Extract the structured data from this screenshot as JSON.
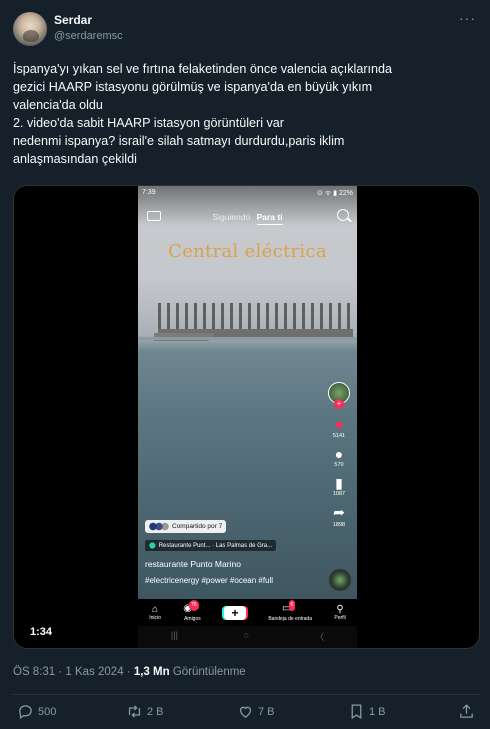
{
  "tweet": {
    "author_name": "Serdar",
    "author_handle": "@serdaremsc",
    "more_icon": "···",
    "text_lines": [
      "İspanya'yı yıkan sel ve fırtına felaketinden önce valencia açıklarında",
      "gezici HAARP istasyonu görülmüş ve ispanya'da en büyük yıkım",
      "valencia'da oldu",
      "2. video'da sabit HAARP istasyon görüntüleri var",
      "nedenmi ispanya? israil'e silah satmayı durdurdu,paris iklim",
      "anlaşmasından çekildi"
    ],
    "timestamp": "ÖS 8:31 · 1 Kas 2024 · ",
    "views_count": "1,3 Mn",
    "views_label": " Görüntülenme"
  },
  "video": {
    "duration": "1:34",
    "status_time": "7:39",
    "status_right": "⊙ ᯤ ▮ 22%",
    "tabs": [
      "Siguiendo",
      "Para ti"
    ],
    "overlay_title": "Central eléctrica",
    "sidebar": {
      "likes": "5141",
      "comments": "570",
      "saves": "1087",
      "shares": "1898"
    },
    "shared_label": "Compartido por 7",
    "location_name": "Restaurante Punt...",
    "location_city": "· Las Palmas de Gra...",
    "caption_user": "restaurante Punto Marino",
    "caption_tags": "#electricenergy #power #ocean #full",
    "nav": {
      "home": "Inicio",
      "friends": "Amigos",
      "friends_badge": "76",
      "inbox": "Bandeja de entrada",
      "inbox_badge": "6",
      "profile": "Perfil"
    },
    "sysnav": [
      "|||",
      "○",
      "〈"
    ]
  },
  "actions": {
    "replies": "500",
    "retweets": "2 B",
    "likes": "7 B",
    "bookmarks": "1 B"
  },
  "icons": [
    "reply-icon",
    "retweet-icon",
    "like-icon",
    "bookmark-icon",
    "share-icon"
  ],
  "colors": {
    "background": "#15202b",
    "secondary_text": "#8b98a5",
    "overlay_title": "#d8a44a",
    "tiktok_red": "#fe2c55"
  }
}
